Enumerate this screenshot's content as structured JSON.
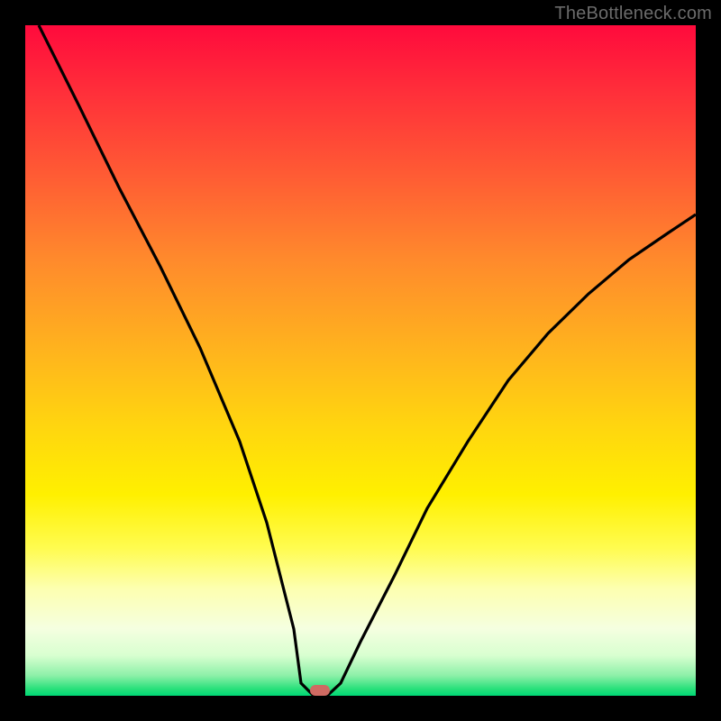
{
  "watermark": "TheBottleneck.com",
  "chart_data": {
    "type": "line",
    "title": "",
    "xlabel": "",
    "ylabel": "",
    "xlim": [
      0,
      100
    ],
    "ylim": [
      0,
      100
    ],
    "grid": false,
    "legend": false,
    "series": [
      {
        "name": "bottleneck-curve",
        "x": [
          2,
          8,
          14,
          20,
          26,
          32,
          36,
          40,
          41,
          43,
          45,
          47,
          50,
          55,
          60,
          66,
          72,
          78,
          84,
          90,
          96,
          100
        ],
        "y": [
          100,
          88,
          76,
          64,
          52,
          38,
          26,
          10,
          2,
          0,
          0,
          2,
          8,
          18,
          28,
          38,
          47,
          54,
          60,
          65,
          69,
          72
        ]
      }
    ],
    "marker": {
      "name": "optimal-point",
      "x": 43.5,
      "y": 0,
      "color": "#cf6a62",
      "shape": "pill"
    },
    "background": {
      "type": "gradient-vertical",
      "stops": [
        {
          "pos": 0,
          "color": "#ff0a3c"
        },
        {
          "pos": 50,
          "color": "#ffd60f"
        },
        {
          "pos": 85,
          "color": "#fdffb0"
        },
        {
          "pos": 100,
          "color": "#00d876"
        }
      ]
    },
    "frame_color": "#000000"
  }
}
